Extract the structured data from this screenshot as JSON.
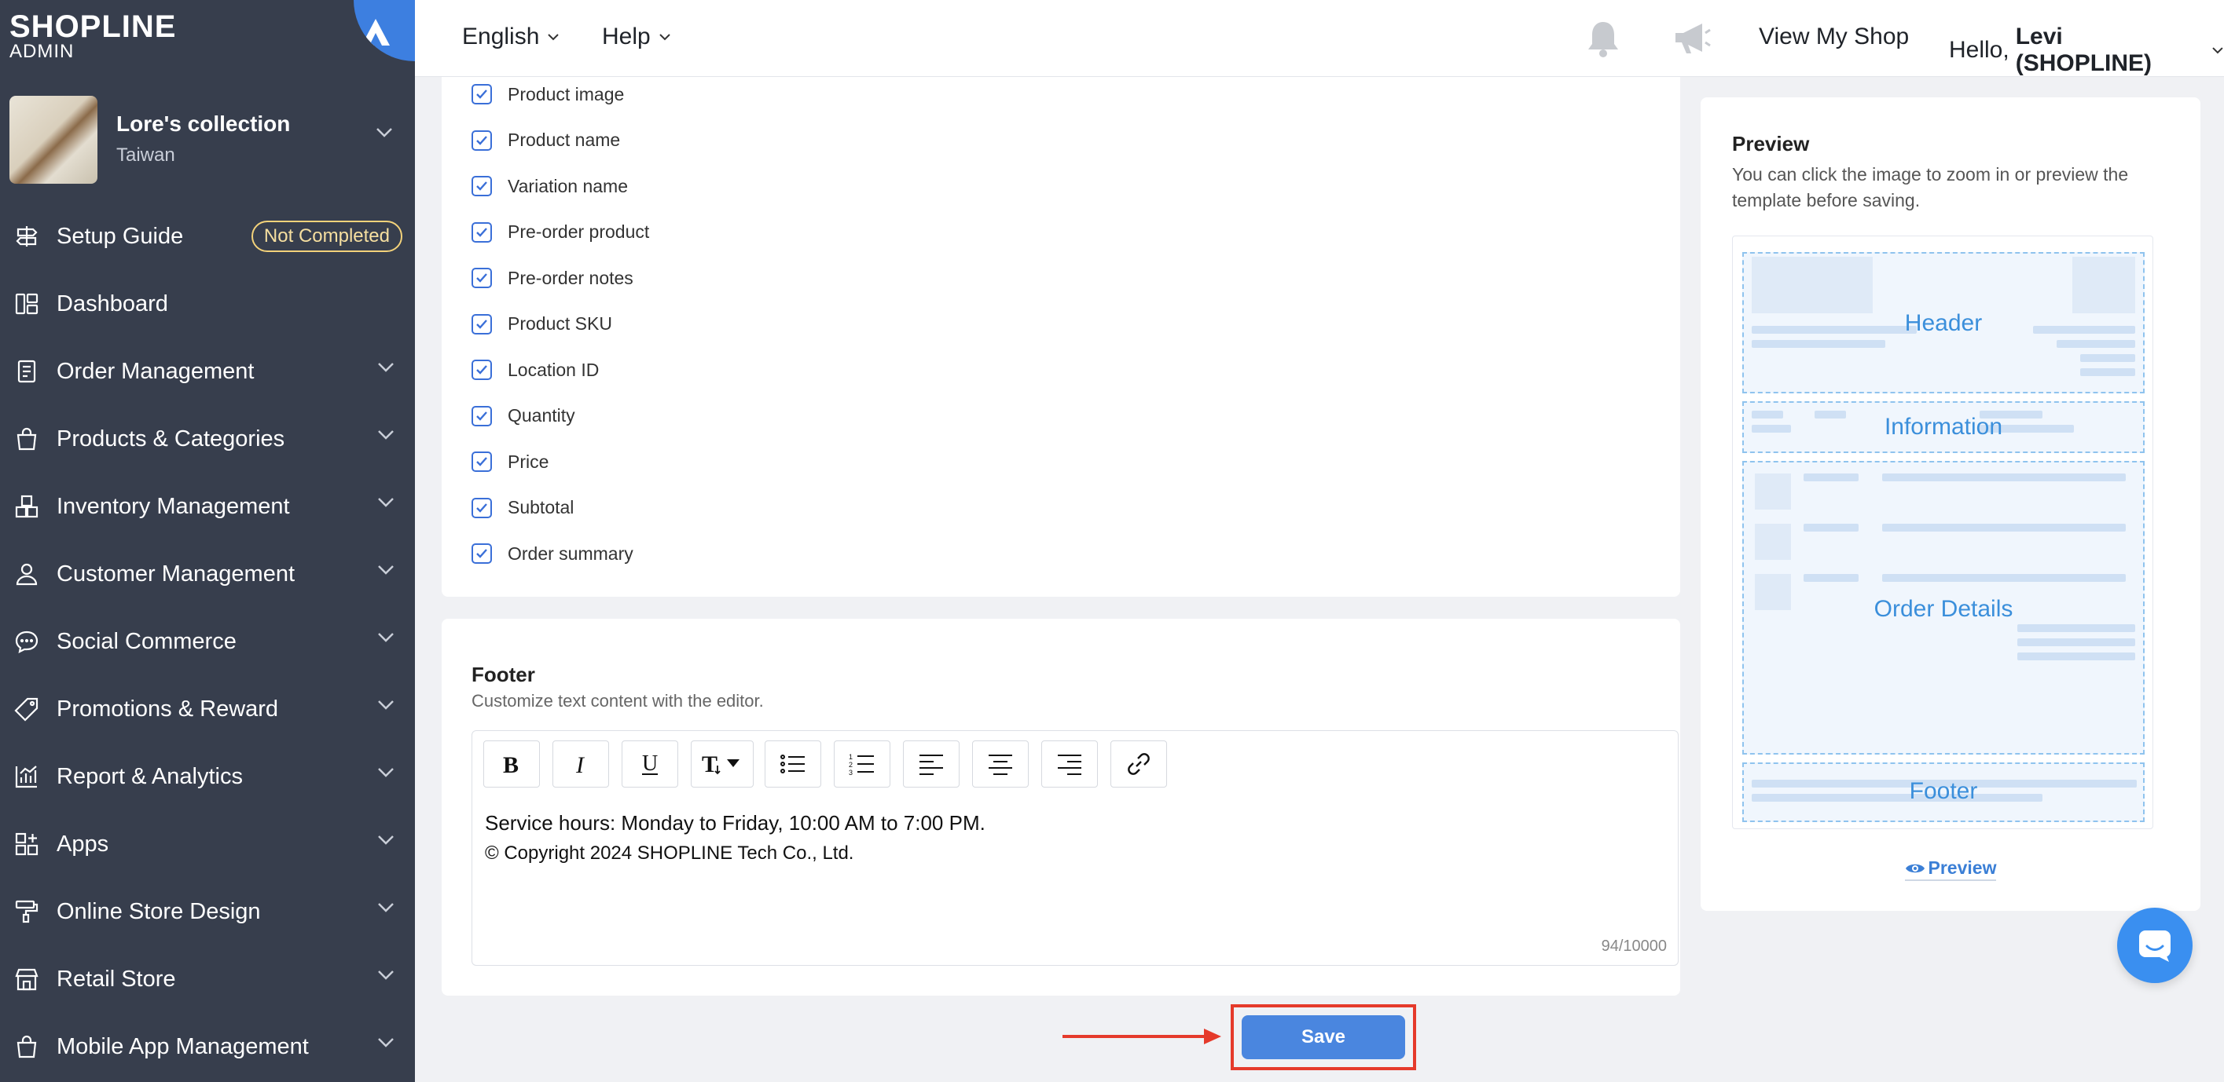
{
  "sidebar": {
    "logo": "SHOPLINE",
    "logo_sub": "ADMIN",
    "store": {
      "name": "Lore's collection",
      "region": "Taiwan"
    },
    "items": [
      {
        "label": "Setup Guide",
        "badge": "Not Completed",
        "icon": "signpost-icon"
      },
      {
        "label": "Dashboard",
        "icon": "dashboard-icon"
      },
      {
        "label": "Order Management",
        "icon": "order-icon"
      },
      {
        "label": "Products & Categories",
        "icon": "bag-icon"
      },
      {
        "label": "Inventory Management",
        "icon": "boxes-icon"
      },
      {
        "label": "Customer Management",
        "icon": "person-icon"
      },
      {
        "label": "Social Commerce",
        "icon": "chat-bubble-icon"
      },
      {
        "label": "Promotions & Reward",
        "icon": "tag-icon"
      },
      {
        "label": "Report & Analytics",
        "icon": "chart-icon"
      },
      {
        "label": "Apps",
        "icon": "apps-icon"
      },
      {
        "label": "Online Store Design",
        "icon": "paint-roller-icon"
      },
      {
        "label": "Retail Store",
        "icon": "store-icon"
      },
      {
        "label": "Mobile App Management",
        "icon": "mobile-bag-icon"
      }
    ]
  },
  "topbar": {
    "language": "English",
    "help": "Help",
    "view_shop": "View My Shop",
    "hello": "Hello,",
    "user": "Levi (SHOPLINE)"
  },
  "fields": {
    "items": [
      "Product image",
      "Product name",
      "Variation name",
      "Pre-order product",
      "Pre-order notes",
      "Product SKU",
      "Location ID",
      "Quantity",
      "Price",
      "Subtotal",
      "Order summary"
    ]
  },
  "footer_section": {
    "title": "Footer",
    "description": "Customize text content with the editor.",
    "content_line1": "Service hours: Monday to Friday, 10:00 AM to 7:00 PM.",
    "content_line2": "© Copyright 2024 SHOPLINE Tech Co., Ltd.",
    "counter": "94/10000"
  },
  "preview": {
    "title": "Preview",
    "description": "You can click the image to zoom in or preview the template before saving.",
    "zones": {
      "header": "Header",
      "information": "Information",
      "order_details": "Order Details",
      "footer": "Footer"
    },
    "link": "Preview"
  },
  "actions": {
    "save": "Save"
  },
  "colors": {
    "sidebar": "#373e4d",
    "accent": "#4a86df",
    "highlight": "#e53a2b",
    "badge": "#f3d27a"
  }
}
